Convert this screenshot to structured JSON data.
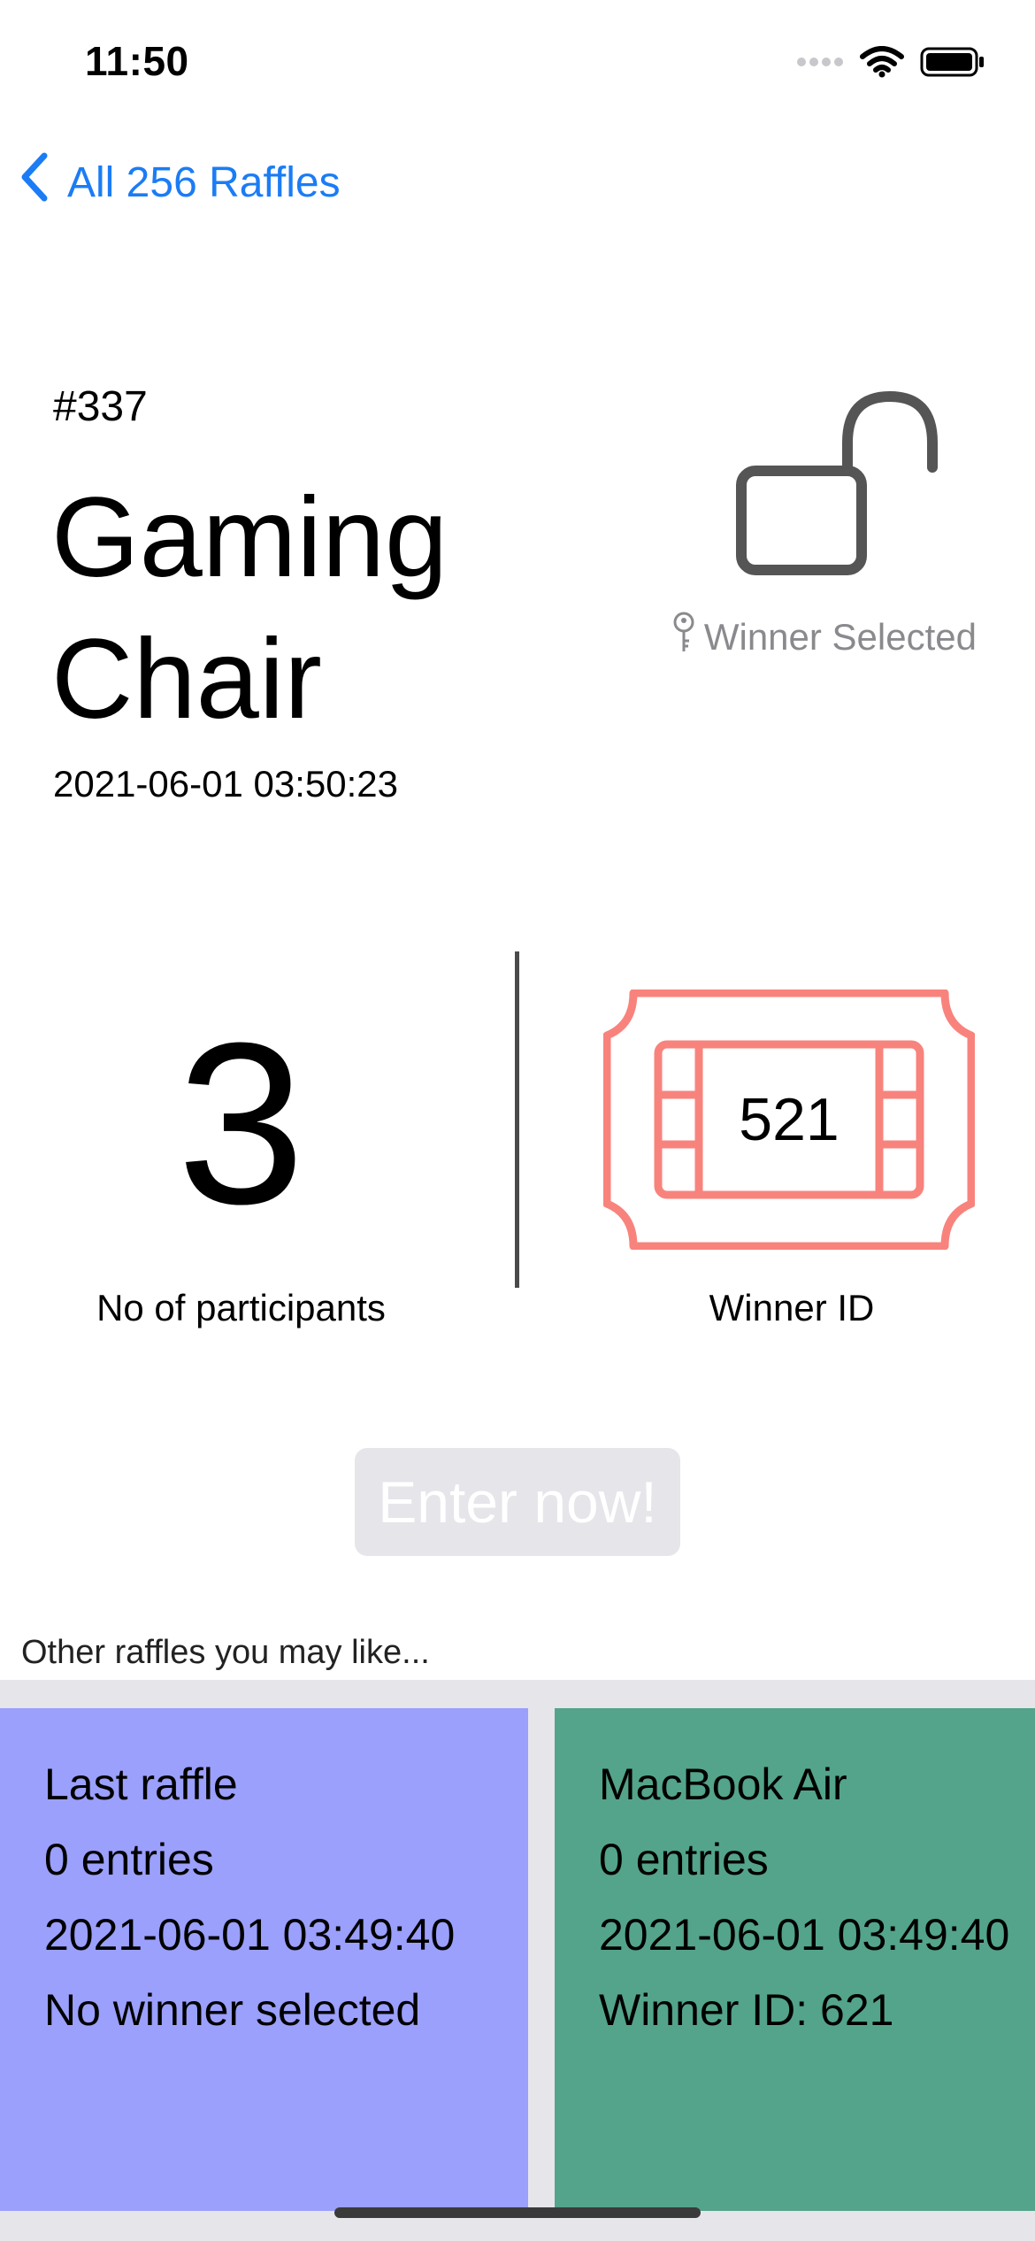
{
  "status_bar": {
    "time": "11:50"
  },
  "nav": {
    "back_label": "All 256 Raffles"
  },
  "raffle": {
    "number": "#337",
    "title": "Gaming Chair",
    "date": "2021-06-01 03:50:23",
    "lock_status": "Winner Selected",
    "participants": "3",
    "participants_label": "No of participants",
    "winner_id": "521",
    "winner_label": "Winner ID"
  },
  "enter_button_label": "Enter now!",
  "recommendations": {
    "heading": "Other raffles you may like...",
    "cards": [
      {
        "title": "Last raffle",
        "entries": "0 entries",
        "date": "2021-06-01 03:49:40",
        "winner": "No winner selected",
        "color": "#9aa0fb"
      },
      {
        "title": "MacBook Air",
        "entries": "0 entries",
        "date": "2021-06-01 03:49:40",
        "winner": "Winner ID: 621",
        "color": "#53a48a"
      }
    ]
  },
  "colors": {
    "accent": "#1b7cf5",
    "ticket": "#f8837d",
    "button_disabled": "#e5e5ea"
  },
  "icons": [
    "signal-icon",
    "wifi-icon",
    "battery-icon",
    "back-chevron-icon",
    "unlocked-lock-icon",
    "key-icon",
    "ticket-icon"
  ]
}
